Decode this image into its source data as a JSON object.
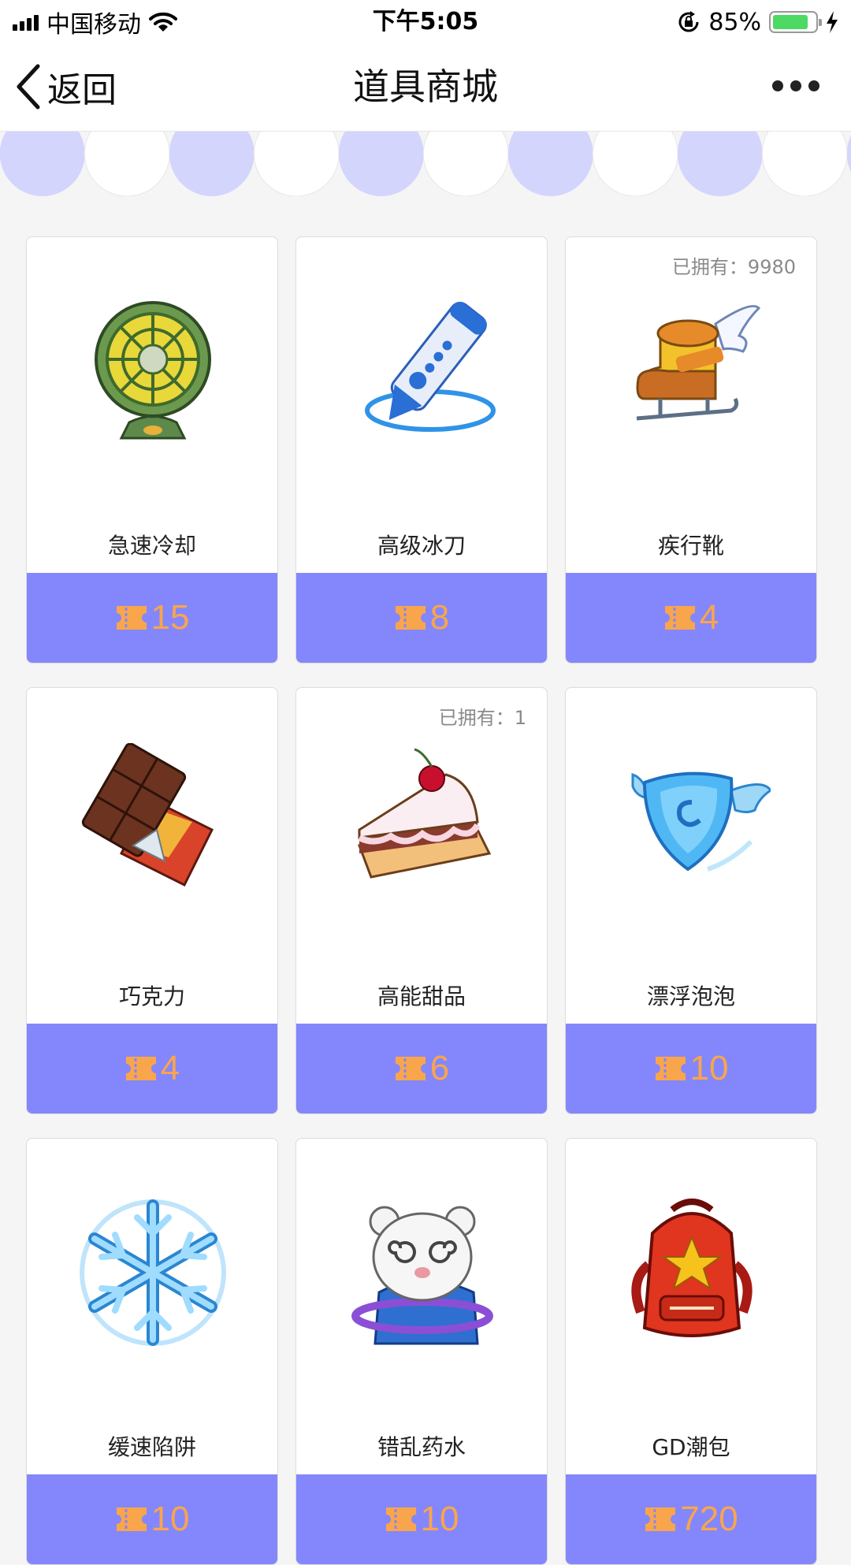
{
  "status_bar": {
    "carrier": "中国移动",
    "time": "下午5:05",
    "battery": "85%",
    "battery_level": 0.85,
    "icons": [
      "signal-icon",
      "wifi-icon",
      "orientation-lock-icon",
      "battery-icon",
      "charging-bolt-icon"
    ]
  },
  "nav": {
    "back_label": "返回",
    "title": "道具商城",
    "more_icon": "more-dots-icon"
  },
  "currency_icon": "ticket-icon",
  "colors": {
    "price_bar": "#8487fb",
    "price_text": "#f9a54c",
    "awning_purple": "#d4d5fd"
  },
  "items": [
    {
      "name": "急速冷却",
      "price": "15",
      "owned": "",
      "icon": "fan-icon"
    },
    {
      "name": "高级冰刀",
      "price": "8",
      "owned": "",
      "icon": "ice-blade-icon"
    },
    {
      "name": "疾行靴",
      "price": "4",
      "owned": "已拥有：9980",
      "icon": "winged-skate-icon"
    },
    {
      "name": "巧克力",
      "price": "4",
      "owned": "",
      "icon": "chocolate-icon"
    },
    {
      "name": "高能甜品",
      "price": "6",
      "owned": "已拥有：1",
      "icon": "cake-icon"
    },
    {
      "name": "漂浮泡泡",
      "price": "10",
      "owned": "",
      "icon": "winged-shield-icon"
    },
    {
      "name": "缓速陷阱",
      "price": "10",
      "owned": "",
      "icon": "snowflake-icon"
    },
    {
      "name": "错乱药水",
      "price": "10",
      "owned": "",
      "icon": "dizzy-bear-icon"
    },
    {
      "name": "GD潮包",
      "price": "720",
      "owned": "",
      "icon": "backpack-icon"
    }
  ]
}
